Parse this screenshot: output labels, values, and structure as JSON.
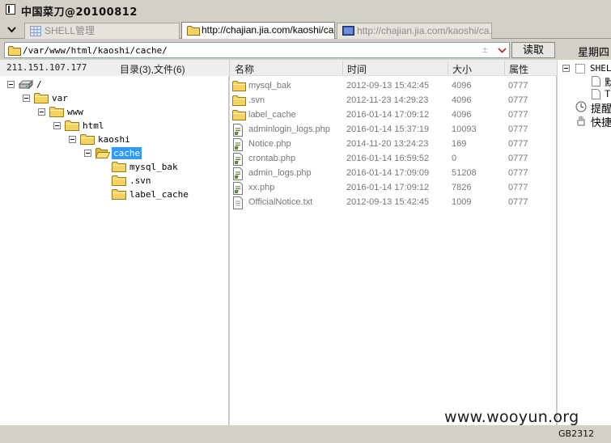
{
  "window": {
    "title": "中国菜刀@20100812"
  },
  "tabs": [
    {
      "label": "SHELL管理",
      "icon": "grid-icon",
      "active": false
    },
    {
      "label": "http://chajian.jia.com/kaoshi/ca...",
      "icon": "folder-icon",
      "active": true
    },
    {
      "label": "http://chajian.jia.com/kaoshi/ca...",
      "icon": "screen-icon",
      "active": false
    }
  ],
  "address": {
    "path": "/var/www/html/kaoshi/cache/",
    "plus_minus": "±",
    "read_label": "读取"
  },
  "weekday": "星期四",
  "left_panel": {
    "ip": "211.151.107.177",
    "counts": "目录(3),文件(6)",
    "tree": [
      {
        "label": "/",
        "icon": "drive-icon"
      },
      {
        "label": "var",
        "icon": "folder-icon"
      },
      {
        "label": "www",
        "icon": "folder-icon"
      },
      {
        "label": "html",
        "icon": "folder-icon"
      },
      {
        "label": "kaoshi",
        "icon": "folder-icon"
      },
      {
        "label": "cache",
        "icon": "folder-open-icon",
        "selected": true
      },
      {
        "label": "mysql_bak",
        "icon": "folder-icon"
      },
      {
        "label": ".svn",
        "icon": "folder-icon"
      },
      {
        "label": "label_cache",
        "icon": "folder-icon"
      }
    ]
  },
  "file_list": {
    "columns": {
      "name": "名称",
      "time": "时间",
      "size": "大小",
      "perm": "属性"
    },
    "rows": [
      {
        "name": "mysql_bak",
        "time": "2012-09-13 15:42:45",
        "size": "4096",
        "perm": "0777",
        "icon": "folder-icon"
      },
      {
        "name": ".svn",
        "time": "2012-11-23 14:29:23",
        "size": "4096",
        "perm": "0777",
        "icon": "folder-icon"
      },
      {
        "name": "label_cache",
        "time": "2016-01-14 17:09:12",
        "size": "4096",
        "perm": "0777",
        "icon": "folder-icon"
      },
      {
        "name": "adminlogin_logs.php",
        "time": "2016-01-14 15:37:19",
        "size": "10093",
        "perm": "0777",
        "icon": "php-file-icon"
      },
      {
        "name": "Notice.php",
        "time": "2014-11-20 13:24:23",
        "size": "169",
        "perm": "0777",
        "icon": "php-file-icon"
      },
      {
        "name": "crontab.php",
        "time": "2016-01-14 16:59:52",
        "size": "0",
        "perm": "0777",
        "icon": "php-file-icon"
      },
      {
        "name": "admin_logs.php",
        "time": "2016-01-14 17:09:09",
        "size": "51208",
        "perm": "0777",
        "icon": "php-file-icon"
      },
      {
        "name": "xx.php",
        "time": "2016-01-14 17:09:12",
        "size": "7826",
        "perm": "0777",
        "icon": "php-file-icon"
      },
      {
        "name": "OfficialNotice.txt",
        "time": "2012-09-13 15:42:45",
        "size": "1009",
        "perm": "0777",
        "icon": "text-file-icon"
      }
    ]
  },
  "right_panel": {
    "root": "SHELL",
    "children": [
      "默",
      "T"
    ],
    "reminder": "提醒",
    "shortcut": "快捷"
  },
  "status": {
    "encoding": "GB2312",
    "watermark": "www.wooyun.org"
  },
  "colors": {
    "selection": "#3399ff",
    "folder": "#f6d261",
    "window_bg": "#d4d0c8"
  }
}
